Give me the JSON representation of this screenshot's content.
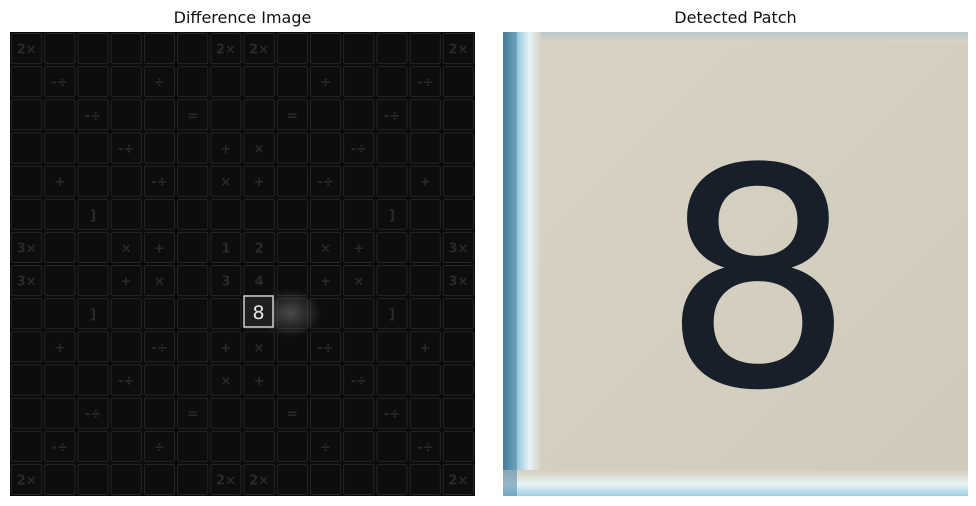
{
  "titles": {
    "left": "Difference Image",
    "right": "Detected Patch"
  },
  "difference_image": {
    "detected_cell_label": "8",
    "board_cells": [
      {
        "r": 0,
        "c": 0,
        "g": "2×"
      },
      {
        "r": 0,
        "c": 6,
        "g": "2×"
      },
      {
        "r": 0,
        "c": 7,
        "g": "2×"
      },
      {
        "r": 0,
        "c": 13,
        "g": "2×"
      },
      {
        "r": 1,
        "c": 1,
        "g": "-÷"
      },
      {
        "r": 1,
        "c": 4,
        "g": "÷"
      },
      {
        "r": 1,
        "c": 9,
        "g": "÷"
      },
      {
        "r": 1,
        "c": 12,
        "g": "-÷"
      },
      {
        "r": 2,
        "c": 2,
        "g": "-÷"
      },
      {
        "r": 2,
        "c": 5,
        "g": "="
      },
      {
        "r": 2,
        "c": 8,
        "g": "="
      },
      {
        "r": 2,
        "c": 11,
        "g": "-÷"
      },
      {
        "r": 3,
        "c": 3,
        "g": "-÷"
      },
      {
        "r": 3,
        "c": 6,
        "g": "+"
      },
      {
        "r": 3,
        "c": 7,
        "g": "×"
      },
      {
        "r": 3,
        "c": 10,
        "g": "-÷"
      },
      {
        "r": 4,
        "c": 1,
        "g": "+"
      },
      {
        "r": 4,
        "c": 4,
        "g": "-÷"
      },
      {
        "r": 4,
        "c": 6,
        "g": "×"
      },
      {
        "r": 4,
        "c": 7,
        "g": "+"
      },
      {
        "r": 4,
        "c": 9,
        "g": "-÷"
      },
      {
        "r": 4,
        "c": 12,
        "g": "+"
      },
      {
        "r": 5,
        "c": 2,
        "g": "]"
      },
      {
        "r": 5,
        "c": 11,
        "g": "]"
      },
      {
        "r": 6,
        "c": 0,
        "g": "3×"
      },
      {
        "r": 6,
        "c": 3,
        "g": "×"
      },
      {
        "r": 6,
        "c": 4,
        "g": "+"
      },
      {
        "r": 6,
        "c": 6,
        "g": "1"
      },
      {
        "r": 6,
        "c": 7,
        "g": "2"
      },
      {
        "r": 6,
        "c": 9,
        "g": "×"
      },
      {
        "r": 6,
        "c": 10,
        "g": "+"
      },
      {
        "r": 6,
        "c": 13,
        "g": "3×"
      },
      {
        "r": 7,
        "c": 0,
        "g": "3×"
      },
      {
        "r": 7,
        "c": 3,
        "g": "+"
      },
      {
        "r": 7,
        "c": 4,
        "g": "×"
      },
      {
        "r": 7,
        "c": 6,
        "g": "3"
      },
      {
        "r": 7,
        "c": 7,
        "g": "4"
      },
      {
        "r": 7,
        "c": 9,
        "g": "+"
      },
      {
        "r": 7,
        "c": 10,
        "g": "×"
      },
      {
        "r": 7,
        "c": 13,
        "g": "3×"
      },
      {
        "r": 8,
        "c": 2,
        "g": "]"
      },
      {
        "r": 8,
        "c": 11,
        "g": "]"
      },
      {
        "r": 9,
        "c": 1,
        "g": "+"
      },
      {
        "r": 9,
        "c": 4,
        "g": "-÷"
      },
      {
        "r": 9,
        "c": 6,
        "g": "+"
      },
      {
        "r": 9,
        "c": 7,
        "g": "×"
      },
      {
        "r": 9,
        "c": 9,
        "g": "-÷"
      },
      {
        "r": 9,
        "c": 12,
        "g": "+"
      },
      {
        "r": 10,
        "c": 3,
        "g": "-÷"
      },
      {
        "r": 10,
        "c": 6,
        "g": "×"
      },
      {
        "r": 10,
        "c": 7,
        "g": "+"
      },
      {
        "r": 10,
        "c": 10,
        "g": "-÷"
      },
      {
        "r": 11,
        "c": 2,
        "g": "-÷"
      },
      {
        "r": 11,
        "c": 5,
        "g": "="
      },
      {
        "r": 11,
        "c": 8,
        "g": "="
      },
      {
        "r": 11,
        "c": 11,
        "g": "-÷"
      },
      {
        "r": 12,
        "c": 1,
        "g": "-÷"
      },
      {
        "r": 12,
        "c": 4,
        "g": "÷"
      },
      {
        "r": 12,
        "c": 9,
        "g": "÷"
      },
      {
        "r": 12,
        "c": 12,
        "g": "-÷"
      },
      {
        "r": 13,
        "c": 0,
        "g": "2×"
      },
      {
        "r": 13,
        "c": 6,
        "g": "2×"
      },
      {
        "r": 13,
        "c": 7,
        "g": "2×"
      },
      {
        "r": 13,
        "c": 13,
        "g": "2×"
      }
    ]
  },
  "detected_patch": {
    "digit": "8"
  }
}
